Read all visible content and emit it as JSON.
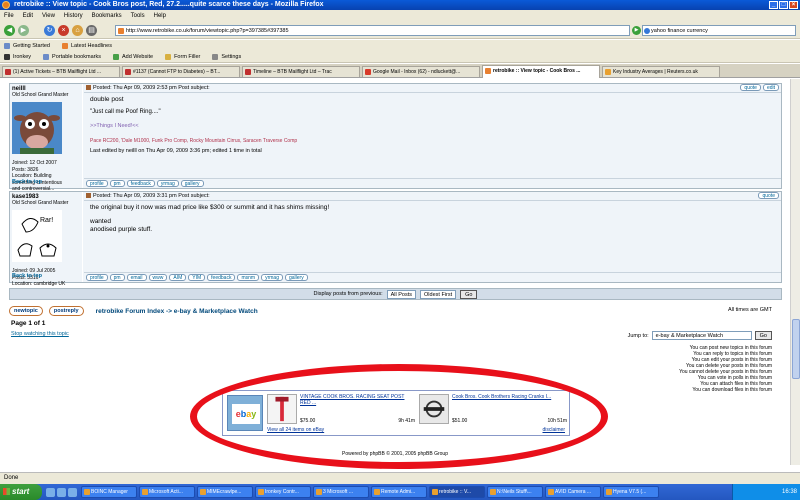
{
  "window": {
    "title": "retrobike :: View topic - Cook Bros post, Red, 27.2.....quite scarce these days - Mozilla Firefox"
  },
  "menu": [
    "File",
    "Edit",
    "View",
    "History",
    "Bookmarks",
    "Tools",
    "Help"
  ],
  "nav": {
    "url": "http://www.retrobike.co.uk/forum/viewtopic.php?p=397385#397385",
    "search": "yahoo finance currency"
  },
  "bookmarks": {
    "row1": [
      "Getting Started",
      "Latest Headlines"
    ],
    "row2": [
      "Ironkey",
      "Portable bookmarks",
      "Add Website",
      "Form Filler",
      "Settings"
    ]
  },
  "tabs": [
    "(1) Active Tickets – BTB Mailflight Ltd ...",
    "#1137 (Cannot FTP to Diabetes) – BT...",
    "Timeline – BTB Mailflight Ltd – Trac",
    "Google Mail - Inbox (62) - ndluckett@...",
    "retrobike :: View topic - Cook Bros ...",
    "Key Industry Averages | Reuters.co.uk"
  ],
  "posts": [
    {
      "username": "neilll",
      "rank": "Old School Grand Master",
      "info": [
        "Joined: 12 Oct 2007",
        "Posts: 3826",
        "Location: Building",
        "something contentious",
        "and controversial..."
      ],
      "header": "Posted: Thu Apr 09, 2009 2:53 pm     Post subject:",
      "header_buttons": [
        "quote",
        "edit"
      ],
      "body": [
        "double post"
      ],
      "sig_quote": "\"Just call me Poof Ring....\"",
      "sig_link": ">>Things I Need!<<",
      "sig_bikes": "Pace RC200, 'Dale M1000, Funk Pro Comp, Rocky Mountain Cirrus, Saracen Traverse Comp",
      "edited": "Last edited by neilll on Thu Apr 09, 2009 3:36 pm; edited 1 time in total",
      "footer_buttons": [
        "profile",
        "pm",
        "feedback",
        "yrmag",
        "gallery"
      ],
      "back": "Back to top"
    },
    {
      "username": "kase1983",
      "rank": "Old School Grand Master",
      "info": [
        "Joined: 09 Jul 2005",
        "Posts: 3316",
        "Location: cambridge UK"
      ],
      "header": "Posted: Thu Apr 09, 2009 3:31 pm     Post subject:",
      "header_buttons": [
        "quote"
      ],
      "body": [
        "the original buy it now was mad price like $300 or summit and it has shims missing!",
        "",
        "wanted",
        "anodised purple stuff."
      ],
      "footer_buttons": [
        "profile",
        "pm",
        "email",
        "www",
        "AIM",
        "YIM",
        "feedback",
        "msnm",
        "yrmag",
        "gallery"
      ],
      "back": "Back to top"
    }
  ],
  "display": {
    "label": "Display posts from previous:",
    "range": "All Posts",
    "order": "Oldest First",
    "go": "Go"
  },
  "actions": {
    "newtopic": "newtopic",
    "postreply": "postreply",
    "breadcrumb": "retrobike Forum Index -> e-bay & Marketplace Watch",
    "timezone": "All times are GMT"
  },
  "page_info": "Page 1 of 1",
  "stop_watching": "Stop watching this topic",
  "jump": {
    "label": "Jump to:",
    "value": "e-bay & Marketplace Watch",
    "go": "Go"
  },
  "permissions": [
    "You can post new topics in this forum",
    "You can reply to topics in this forum",
    "You can edit your posts in this forum",
    "You can delete your posts in this forum",
    "You cannot delete your posts in this forum",
    "You can vote in polls in this forum",
    "You can attach files in this forum",
    "You can download files in this forum"
  ],
  "ad": {
    "logo": "ebay",
    "items": [
      {
        "title": "VINTAGE COOK BROS. RACING SEAT POST RED ...",
        "price": "$75.00",
        "time": "9h 41m"
      },
      {
        "title": "Cook Bros. Cook Brothers Racing Cranks I...",
        "price": "$51.00",
        "time": "10h 51m"
      }
    ],
    "view_all": "View all 24 items on eBay",
    "disclaimer": "disclaimer"
  },
  "powered": "Powered by phpBB © 2001, 2005 phpBB Group",
  "status": "Done",
  "taskbar": {
    "start": "start",
    "buttons": [
      "BOINC Manager",
      "Microsoft Acti...",
      "MIMEcrawlpe...",
      "Ironkey Contr...",
      "3 Microsoft ...",
      "Remote Admi...",
      "retrobike :: V...",
      "N:\\Neils Stuff\\...",
      "AVID Camera ...",
      "Hyena V7.5 (..."
    ],
    "clock": "16:38"
  },
  "colors": {
    "annotation_circle": "#e8101a",
    "titlebar": "#0a5ad8",
    "taskbar": "#3168d5"
  }
}
